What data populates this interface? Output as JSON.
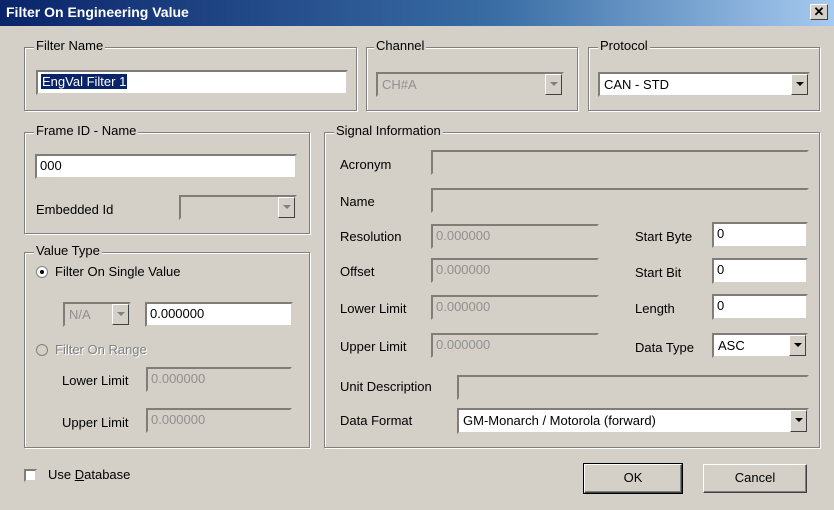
{
  "window": {
    "title": "Filter On Engineering Value",
    "close_glyph": "✕"
  },
  "filter_name": {
    "legend": "Filter Name",
    "value": "EngVal Filter 1"
  },
  "channel": {
    "legend": "Channel",
    "value": "CH#A"
  },
  "protocol": {
    "legend": "Protocol",
    "value": "CAN - STD"
  },
  "frame": {
    "legend": "Frame ID - Name",
    "id_value": "000",
    "embedded_label": "Embedded Id",
    "embedded_value": ""
  },
  "value_type": {
    "legend": "Value Type",
    "single_label": "Filter On Single Value",
    "na_value": "N/A",
    "single_value": "0.000000",
    "range_label": "Filter On Range",
    "lower_label": "Lower Limit",
    "lower_value": "0.000000",
    "upper_label": "Upper Limit",
    "upper_value": "0.000000"
  },
  "signal": {
    "legend": "Signal Information",
    "acronym_label": "Acronym",
    "acronym_value": "",
    "name_label": "Name",
    "name_value": "",
    "resolution_label": "Resolution",
    "resolution_value": "0.000000",
    "offset_label": "Offset",
    "offset_value": "0.000000",
    "lower_label": "Lower Limit",
    "lower_value": "0.000000",
    "upper_label": "Upper Limit",
    "upper_value": "0.000000",
    "start_byte_label": "Start Byte",
    "start_byte_value": "0",
    "start_bit_label": "Start Bit",
    "start_bit_value": "0",
    "length_label": "Length",
    "length_value": "0",
    "data_type_label": "Data Type",
    "data_type_value": "ASC",
    "unit_label": "Unit Description",
    "unit_value": "",
    "format_label": "Data Format",
    "format_value": "GM-Monarch / Motorola (forward)"
  },
  "use_database": {
    "label_pre": "Use ",
    "label_mnemonic": "D",
    "label_post": "atabase"
  },
  "buttons": {
    "ok": "OK",
    "cancel": "Cancel"
  }
}
